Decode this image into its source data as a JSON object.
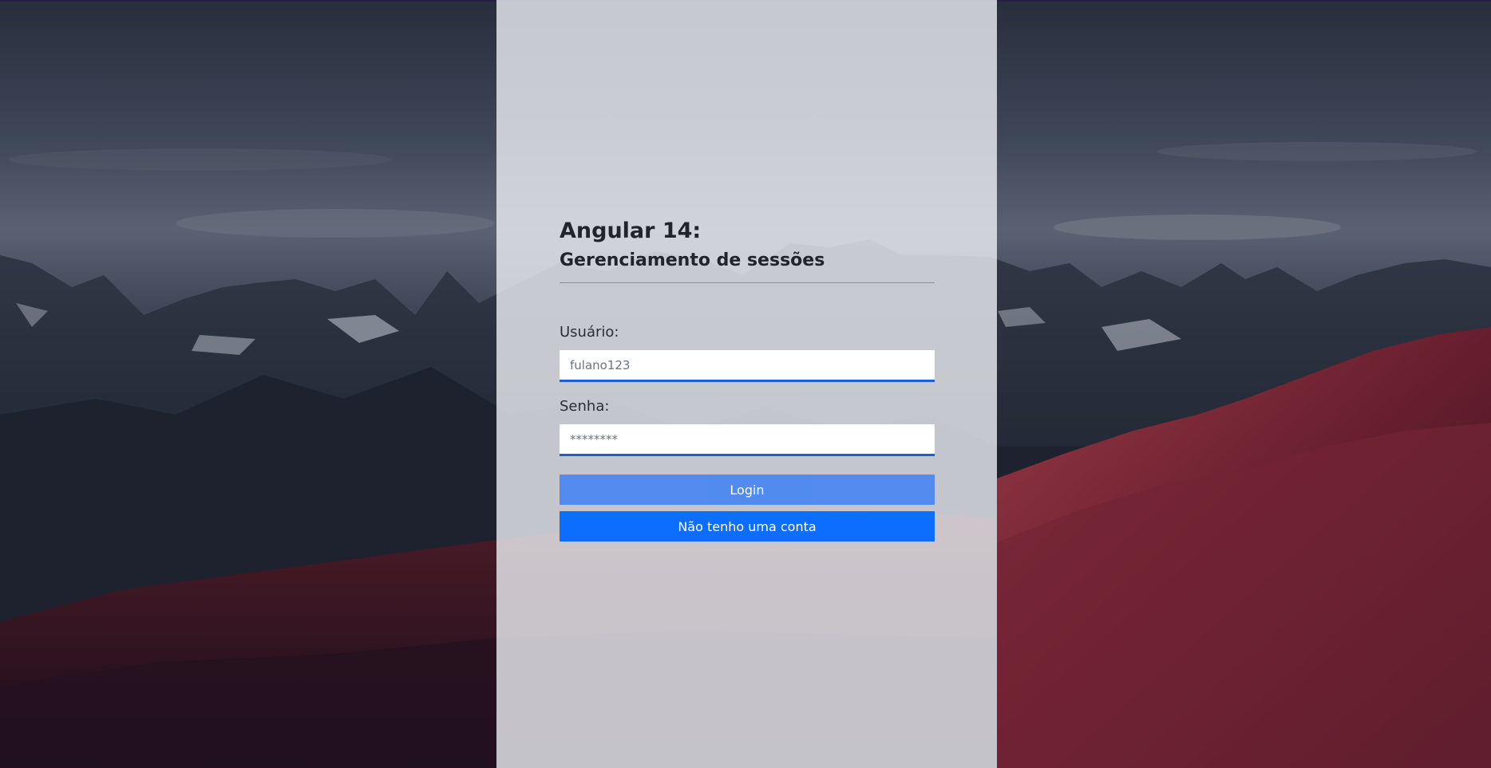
{
  "header": {
    "title": "Angular 14:",
    "subtitle": "Gerenciamento de sessões"
  },
  "form": {
    "username": {
      "label": "Usuário:",
      "value": "fulano123",
      "placeholder": "fulano123"
    },
    "password": {
      "label": "Senha:",
      "value": "",
      "placeholder": "********"
    },
    "login_button": "Login",
    "signup_button": "Não tenho uma conta"
  },
  "colors": {
    "primary": "#0d6efd",
    "login_button": "#4d88f0",
    "input_underline": "#1f5fd1",
    "panel": "#eef0f4"
  }
}
